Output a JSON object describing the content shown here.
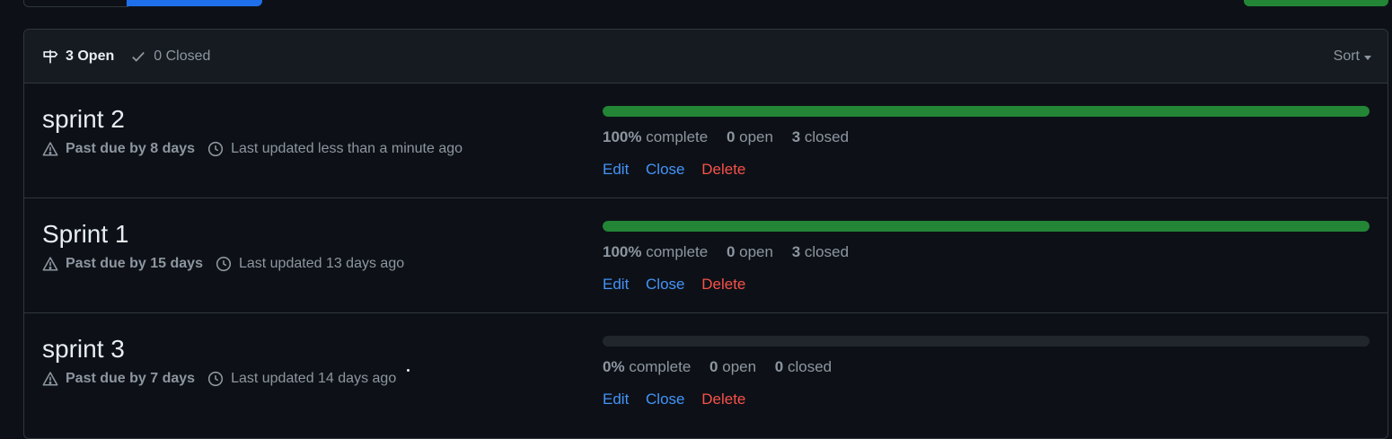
{
  "header": {
    "open_count": "3 Open",
    "closed_count": "0 Closed",
    "sort_label": "Sort"
  },
  "milestones": [
    {
      "title": "sprint 2",
      "due": "Past due by 8 days",
      "updated": "Last updated less than a minute ago",
      "percent": "100%",
      "percent_value": 100,
      "complete_label": "complete",
      "open": "0",
      "open_label": "open",
      "closed": "3",
      "closed_label": "closed",
      "edit": "Edit",
      "close": "Close",
      "delete": "Delete"
    },
    {
      "title": "Sprint 1",
      "due": "Past due by 15 days",
      "updated": "Last updated 13 days ago",
      "percent": "100%",
      "percent_value": 100,
      "complete_label": "complete",
      "open": "0",
      "open_label": "open",
      "closed": "3",
      "closed_label": "closed",
      "edit": "Edit",
      "close": "Close",
      "delete": "Delete"
    },
    {
      "title": "sprint 3",
      "due": "Past due by 7 days",
      "updated": "Last updated 14 days ago",
      "percent": "0%",
      "percent_value": 0,
      "complete_label": "complete",
      "open": "0",
      "open_label": "open",
      "closed": "0",
      "closed_label": "closed",
      "edit": "Edit",
      "close": "Close",
      "delete": "Delete"
    }
  ],
  "colors": {
    "background": "#0d1117",
    "header_bg": "#161b22",
    "border": "#30363d",
    "progress_fill": "#238636",
    "link": "#4493f8",
    "danger": "#f85149",
    "muted": "#8d96a0"
  },
  "icons": {
    "open": "milestone-icon",
    "closed": "check-icon",
    "due": "alert-icon",
    "updated": "clock-icon"
  }
}
